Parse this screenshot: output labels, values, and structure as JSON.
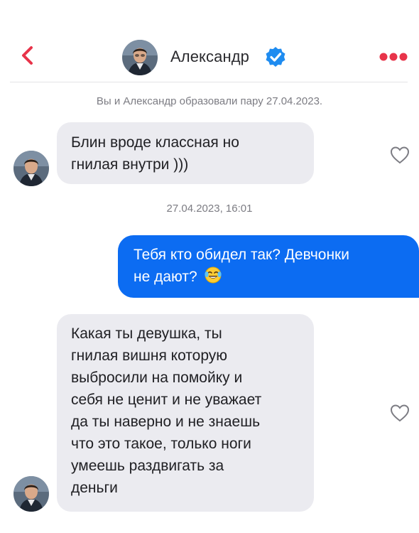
{
  "header": {
    "contact_name": "Александр",
    "back_icon": "chevron-left-icon",
    "verified_icon": "verified-badge-icon",
    "more_icon": "more-dots-icon",
    "accent_color": "#e8344a",
    "verified_color": "#1f8cf0"
  },
  "chat": {
    "match_note": "Вы и Александр образовали пару 27.04.2023.",
    "timestamp": "27.04.2023, 16:01",
    "messages": [
      {
        "direction": "incoming",
        "lines": [
          "Блин вроде классная но",
          "гнилая внутри )))"
        ],
        "liked": false
      },
      {
        "direction": "outgoing",
        "lines": [
          "Тебя кто обидел так? Девчонки",
          "не дают?"
        ],
        "emoji": "face-with-tears-of-joy"
      },
      {
        "direction": "incoming",
        "lines": [
          "Какая ты девушка, ты",
          "гнилая вишня которую",
          "выбросили на помойку и",
          "себя не ценит и не уважает",
          "да ты наверно и не знаешь",
          "что это такое, только ноги",
          "умеешь раздвигать за",
          "деньги"
        ],
        "liked": false
      }
    ],
    "outgoing_bubble_color": "#0c6cf2",
    "incoming_bubble_color": "#ebebf0"
  }
}
